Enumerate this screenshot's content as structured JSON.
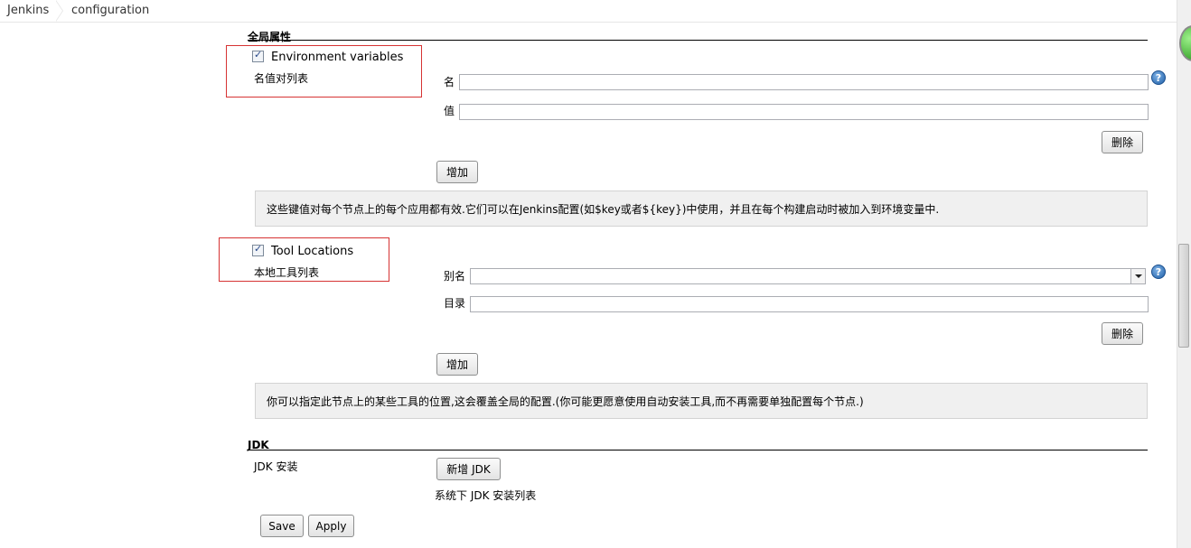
{
  "breadcrumb": [
    "Jenkins",
    "configuration"
  ],
  "global_properties": {
    "title": "全局属性"
  },
  "env_vars": {
    "checkbox_label": "Environment variables",
    "checked": true,
    "sublabel": "名值对列表",
    "name_label": "名",
    "value_label": "值",
    "name_value": "",
    "value_value": "",
    "delete_label": "删除",
    "add_label": "增加",
    "info": "这些键值对每个节点上的每个应用都有效.它们可以在Jenkins配置(如$key或者${key})中使用，并且在每个构建启动时被加入到环境变量中."
  },
  "tool_locations": {
    "checkbox_label": "Tool Locations",
    "checked": true,
    "sublabel": "本地工具列表",
    "alias_label": "别名",
    "dir_label": "目录",
    "alias_value": "",
    "dir_value": "",
    "delete_label": "删除",
    "add_label": "增加",
    "info": "你可以指定此节点上的某些工具的位置,这会覆盖全局的配置.(你可能更愿意使用自动安装工具,而不再需要单独配置每个节点.)"
  },
  "jdk": {
    "title": "JDK",
    "install_label": "JDK 安装",
    "add_button": "新增 JDK",
    "note": "系统下 JDK 安装列表"
  },
  "footer": {
    "save": "Save",
    "apply": "Apply"
  },
  "icons": {
    "help": "help-icon",
    "dropdown": "chevron-down-icon",
    "status": "status-orb-icon"
  },
  "colors": {
    "highlight_box": "#d63333",
    "help_blue": "#1f5fa8",
    "status_green": "#2c9a1f"
  }
}
